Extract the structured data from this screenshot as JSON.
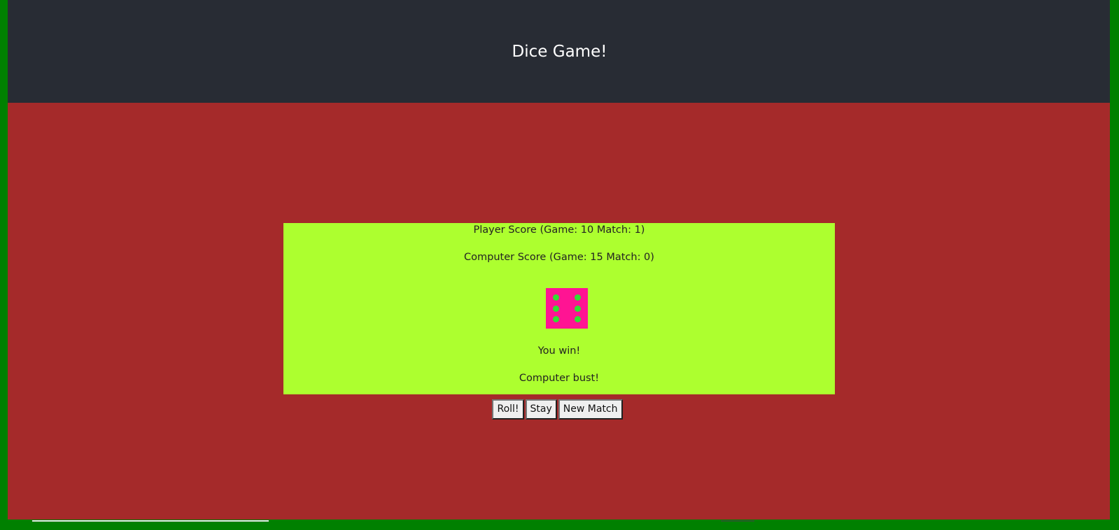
{
  "header": {
    "title": "Dice Game!"
  },
  "scores": {
    "player": "Player Score (Game: 10 Match: 1)",
    "computer": "Computer Score (Game: 15 Match: 0)"
  },
  "die": {
    "value": 6,
    "face_color": "#ff1493",
    "pip_color": "#33dd33"
  },
  "messages": {
    "result": "You win!",
    "detail": "Computer bust!"
  },
  "controls": {
    "roll_label": "Roll!",
    "stay_label": "Stay",
    "new_match_label": "New Match"
  },
  "colors": {
    "page_border": "#008000",
    "header_bg": "#282c34",
    "main_bg": "#a52a2a",
    "board_bg": "#adff2f"
  }
}
